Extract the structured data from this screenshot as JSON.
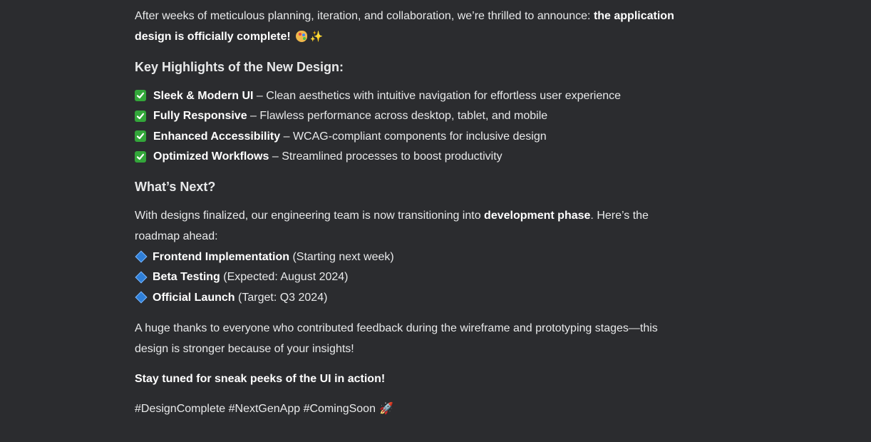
{
  "intro": {
    "text": "After weeks of meticulous planning, iteration, and collaboration, we’re thrilled to announce: ",
    "bold": "the application design is officially complete!",
    "emoji_1": "palette-icon",
    "emoji_2": "sparkles-icon"
  },
  "highlights": {
    "title": "Key Highlights of the New Design:",
    "icon": "check-mark-icon",
    "items": [
      {
        "bold": "Sleek & Modern UI",
        "text": "Clean aesthetics with intuitive navigation for effortless user experience"
      },
      {
        "bold": "Fully Responsive",
        "text": "Flawless performance across desktop, tablet, and mobile"
      },
      {
        "bold": "Enhanced Accessibility",
        "text": "WCAG-compliant components for inclusive design"
      },
      {
        "bold": "Optimized Workflows",
        "text": "Streamlined processes to boost productivity"
      }
    ],
    "separator": " – "
  },
  "next": {
    "title": "What’s Next?",
    "text_before": "With designs finalized, our engineering team is now transitioning into ",
    "bold": "development phase",
    "text_after": ". Here’s the roadmap ahead:",
    "icon": "blue-diamond-icon",
    "items": [
      {
        "bold": "Frontend Implementation",
        "text": "(Starting next week)"
      },
      {
        "bold": "Beta Testing",
        "text": "(Expected: August 2024)"
      },
      {
        "bold": "Official Launch",
        "text": "(Target: Q3 2024)"
      }
    ]
  },
  "thanks": "A huge thanks to everyone who contributed feedback during the wireframe and prototyping stages—this design is stronger because of your insights!",
  "closing": "Stay tuned for sneak peeks of the UI in action!",
  "hashtags": "#DesignComplete #NextGenApp #ComingSoon",
  "hashtag_emoji": "rocket-icon",
  "colors": {
    "background": "#2b2c2f",
    "text": "#e8e9ea",
    "check": "#33a63a",
    "diamond": "#2f7fd8"
  }
}
